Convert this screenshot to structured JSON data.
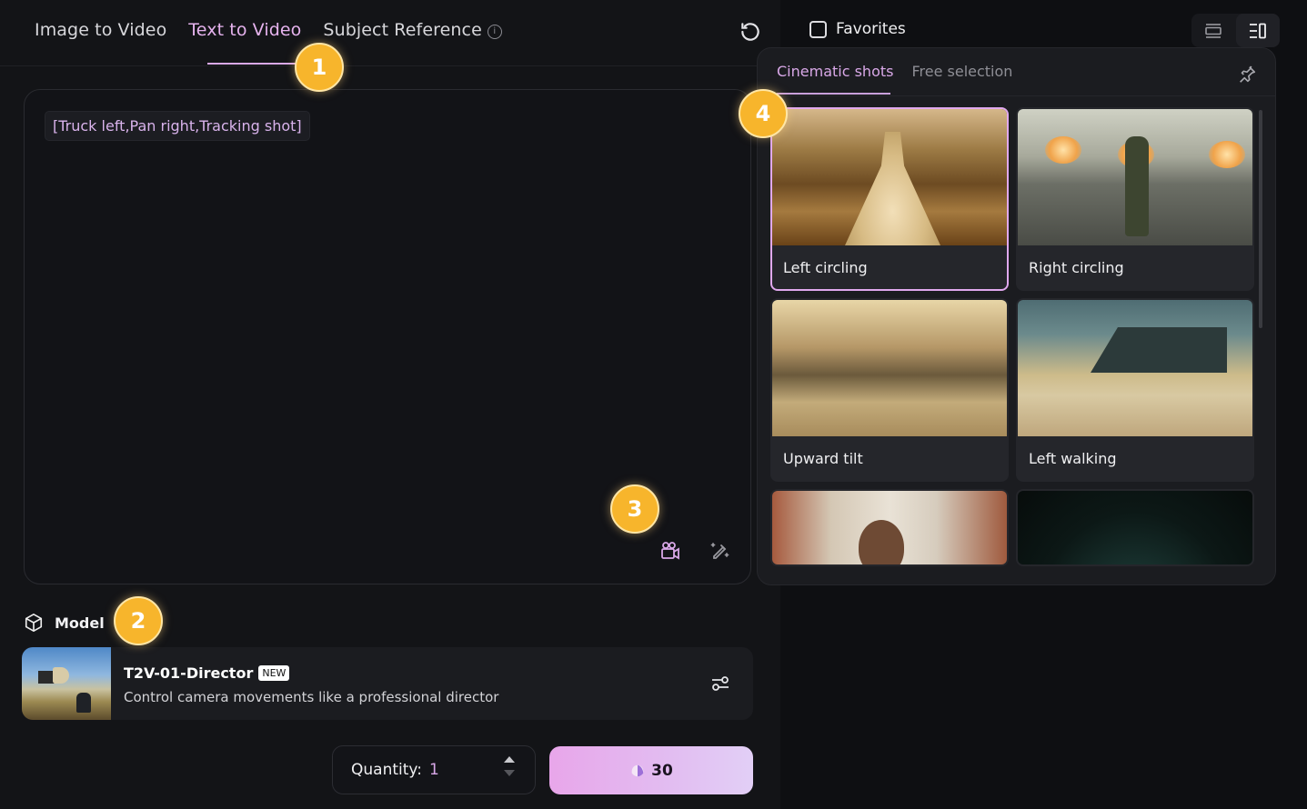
{
  "header": {
    "tabs": [
      {
        "label": "Image to Video",
        "active": false
      },
      {
        "label": "Text to Video",
        "active": true
      },
      {
        "label": "Subject Reference",
        "active": false,
        "info_icon": "info-icon"
      }
    ],
    "refresh_icon": "refresh-icon"
  },
  "prompt": {
    "chip_text": "[Truck left,Pan right,Tracking shot]",
    "camera_button_icon": "camera-movement-icon",
    "enhance_button_icon": "magic-pen-icon"
  },
  "model": {
    "section_label": "Model",
    "section_icon": "cube-icon",
    "name": "T2V-01-Director",
    "badge": "NEW",
    "description": "Control camera movements like a professional director",
    "settings_icon": "sliders-icon"
  },
  "footer": {
    "quantity_label": "Quantity:",
    "quantity_value": "1",
    "generate_cost": "30",
    "cost_icon": "shell-icon"
  },
  "right_panel": {
    "favorites_label": "Favorites",
    "favorites_checked": false,
    "view_modes": [
      "list-view-icon",
      "side-panel-view-icon"
    ],
    "active_view": "side-panel-view-icon"
  },
  "shot_panel": {
    "tabs": [
      {
        "label": "Cinematic shots",
        "active": true
      },
      {
        "label": "Free selection",
        "active": false
      }
    ],
    "pin_icon": "pin-icon",
    "shots": [
      {
        "label": "Left circling",
        "selected": true
      },
      {
        "label": "Right circling",
        "selected": false
      },
      {
        "label": "Upward tilt",
        "selected": false
      },
      {
        "label": "Left walking",
        "selected": false
      },
      {
        "label": "",
        "selected": false
      },
      {
        "label": "",
        "selected": false
      }
    ]
  },
  "annotations": [
    "1",
    "2",
    "3",
    "4"
  ],
  "colors": {
    "accent": "#d9a8e8",
    "badge": "#f7b52c",
    "background": "#131417",
    "panel": "#1b1c20"
  }
}
